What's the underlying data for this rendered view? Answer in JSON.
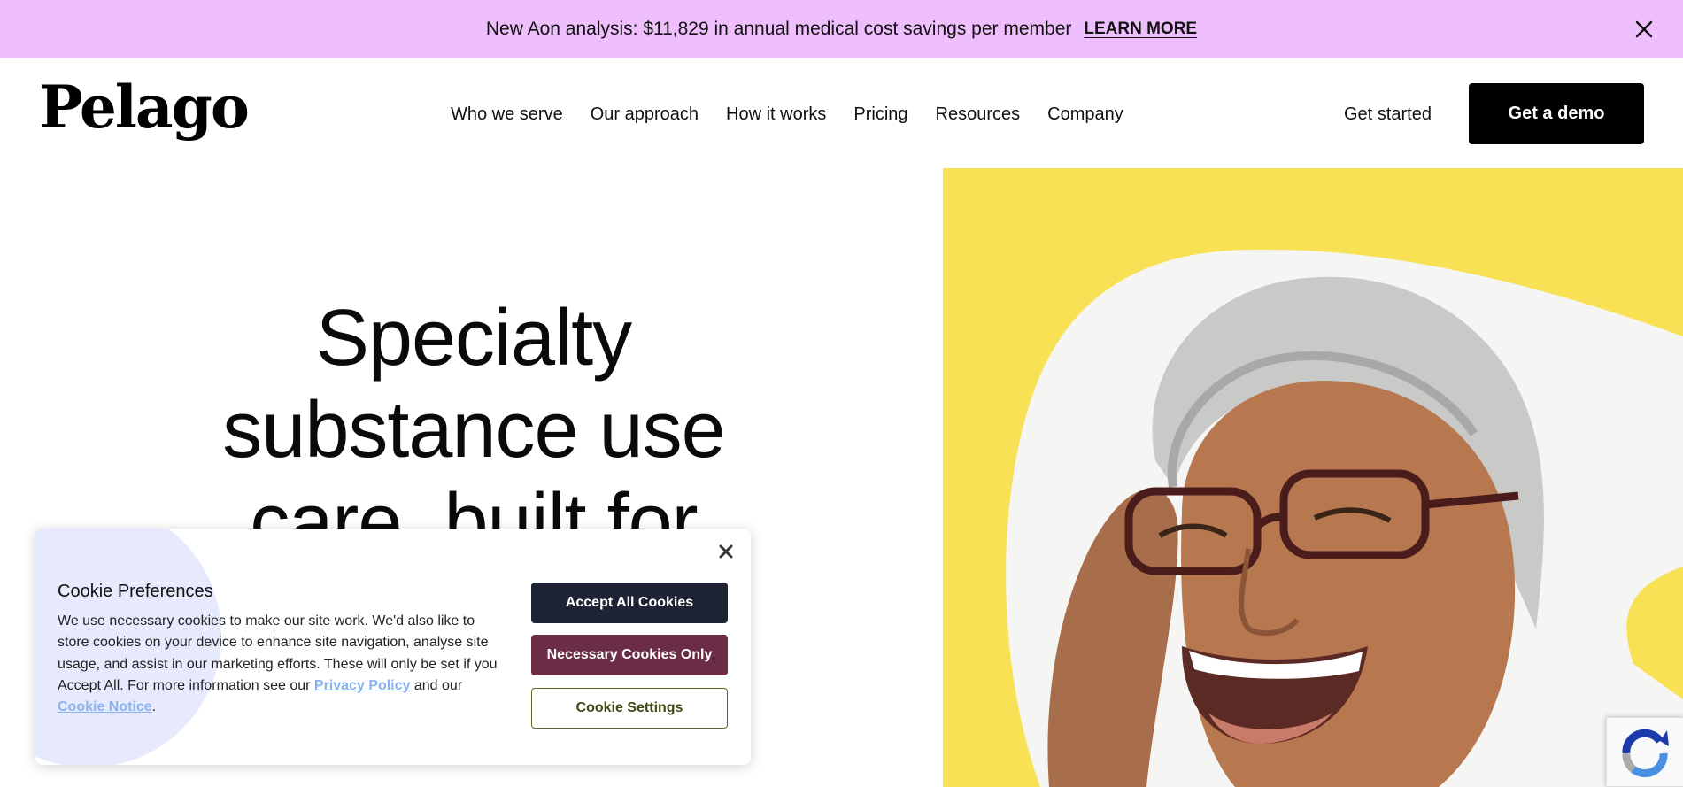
{
  "banner": {
    "text": "New Aon analysis: $11,829 in annual medical cost savings per member",
    "link_label": "LEARN MORE",
    "close_icon": "close-icon"
  },
  "header": {
    "logo_text": "Pelago",
    "nav": [
      "Who we serve",
      "Our approach",
      "How it works",
      "Pricing",
      "Resources",
      "Company"
    ],
    "get_started_label": "Get started",
    "demo_label": "Get a demo"
  },
  "hero": {
    "heading": "Specialty substance use care, built for",
    "image_icon": "photo-smiling-woman-with-glasses",
    "background_color": "#f9e156"
  },
  "cookie_dialog": {
    "title": "Cookie Preferences",
    "body_text": "We use necessary cookies to make our site work. We'd also like to store cookies on your device to enhance site navigation, analyse site usage, and assist in our marketing efforts. These will only be set if you Accept All. For more information see our",
    "privacy_link": "Privacy Policy",
    "and_our": "and our",
    "cookie_notice_link": "Cookie Notice",
    "period": ".",
    "accept_all_label": "Accept All Cookies",
    "necessary_only_label": "Necessary Cookies Only",
    "settings_label": "Cookie Settings",
    "colors": {
      "accept": "#1f2434",
      "necessary": "#6b2c46",
      "settings_border": "#5a6a24"
    }
  },
  "recaptcha": {
    "icon": "recaptcha-icon"
  },
  "colors": {
    "banner_bg": "#eebffc",
    "demo_button": "#000000"
  }
}
